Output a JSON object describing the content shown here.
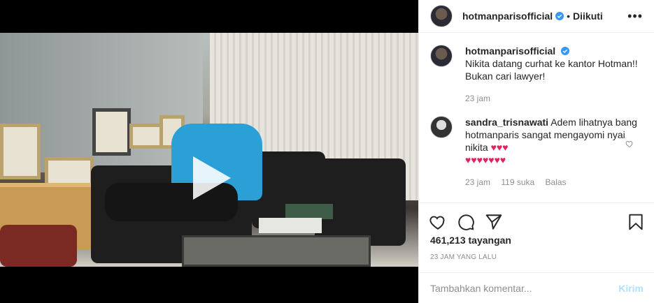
{
  "post": {
    "username": "hotmanparisofficial",
    "follow_status": "Diikuti",
    "more_label": "•••",
    "caption": "Nikita datang curhat ke kantor Hotman!! Bukan cari lawyer!",
    "caption_time": "23 jam"
  },
  "comment": {
    "username": "sandra_trisnawati",
    "text": "Adem lihatnya bang hotmanparis sangat mengayomi nyai nikita",
    "hearts": "♥♥♥",
    "hearts_line2": "♥♥♥♥♥♥♥",
    "time": "23 jam",
    "likes": "119 suka",
    "reply": "Balas"
  },
  "stats": {
    "views": "461,213 tayangan",
    "posted": "23 JAM YANG LALU"
  },
  "add_comment": {
    "placeholder": "Tambahkan komentar...",
    "post_label": "Kirim"
  },
  "colors": {
    "verified": "#3897f0",
    "heart": "#e0245e",
    "post_disabled": "#b2dffc"
  },
  "icons": {
    "play": "play-icon",
    "like": "heart-icon",
    "comment": "comment-icon",
    "share": "share-icon",
    "save": "bookmark-icon",
    "options": "more-icon"
  }
}
